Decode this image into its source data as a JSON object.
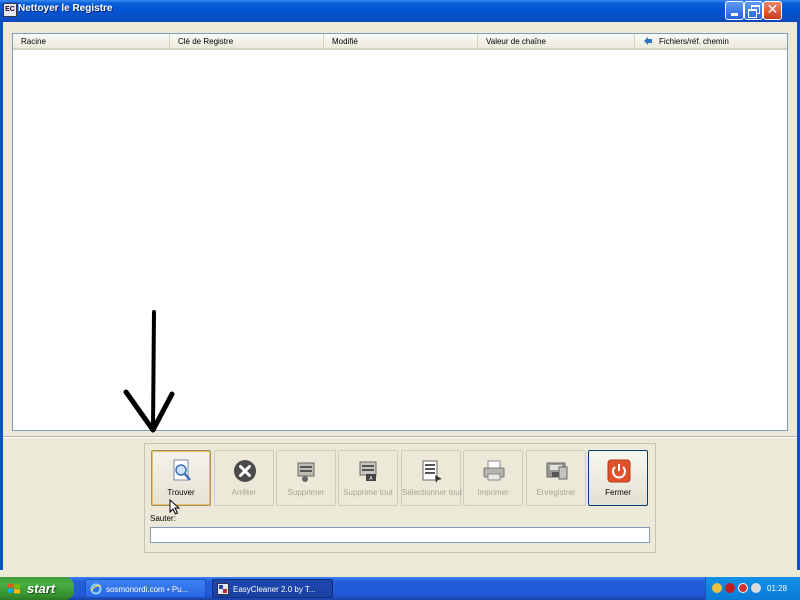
{
  "window": {
    "title": "Nettoyer le Registre",
    "controls": {
      "minimize": "minimize",
      "maximize": "maximize",
      "close": "close"
    }
  },
  "listview": {
    "columns": [
      {
        "label": "Racine"
      },
      {
        "label": "Clé de Registre"
      },
      {
        "label": "Modifié"
      },
      {
        "label": "Valeur de chaîne"
      },
      {
        "label": "Fichiers/réf. chemin",
        "icon": "sort-arrows-icon"
      }
    ],
    "rows": []
  },
  "toolbar": {
    "buttons": [
      {
        "label": "Trouver",
        "icon": "magnifier-document-icon",
        "enabled": true,
        "state": "focused"
      },
      {
        "label": "Arrêter",
        "icon": "stop-x-icon",
        "enabled": false
      },
      {
        "label": "Supprimer",
        "icon": "delete-entries-icon",
        "enabled": false
      },
      {
        "label": "Supprime tout",
        "icon": "delete-all-icon",
        "enabled": false
      },
      {
        "label": "Sélectionner tout",
        "icon": "select-all-icon",
        "enabled": false
      },
      {
        "label": "Imprimer",
        "icon": "printer-icon",
        "enabled": false
      },
      {
        "label": "Enregistrer",
        "icon": "save-icon",
        "enabled": false
      },
      {
        "label": "Fermer",
        "icon": "power-icon",
        "enabled": true
      }
    ],
    "jump_label": "Sauter:",
    "jump_value": ""
  },
  "taskbar": {
    "start_label": "start",
    "tasks": [
      {
        "label": "sosmonordi.com • Pu...",
        "icon": "ie-icon"
      },
      {
        "label": "EasyCleaner 2.0 by T...",
        "icon": "easycleaner-icon",
        "active": true
      }
    ],
    "clock": "01:28"
  },
  "colors": {
    "titlebar": "#0354d4",
    "taskbar": "#245edb",
    "start_button": "#47ae42",
    "close_button": "#c93b18",
    "fermer_icon": "#e0522c"
  }
}
